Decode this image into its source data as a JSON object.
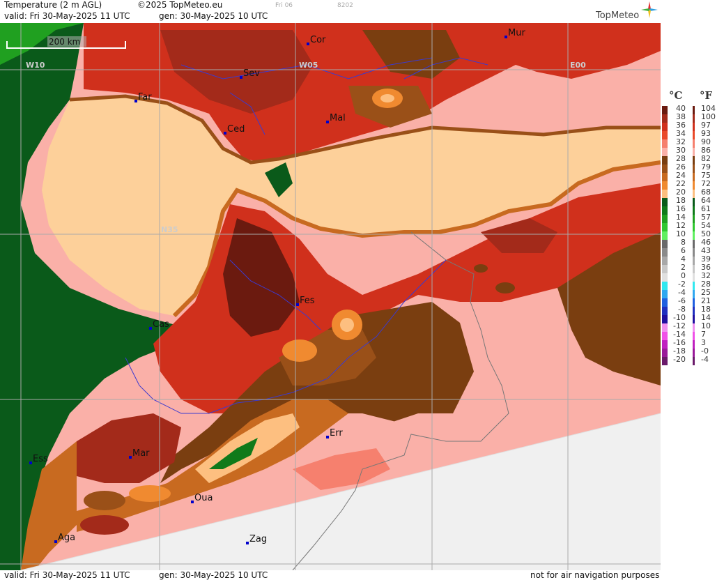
{
  "header": {
    "title": "Temperature (2 m AGL)",
    "copyright": "©2025 TopMeteo.eu",
    "day_tag": "Fri 06",
    "code": "8202",
    "valid": "valid:  Fri  30-May-2025  11 UTC",
    "gen": "gen: 30-May-2025 10 UTC",
    "brand": "TopMeteo"
  },
  "footer": {
    "valid": "valid:  Fri  30-May-2025  11 UTC",
    "gen": "gen: 30-May-2025 10 UTC",
    "notice": "not for air navigation purposes"
  },
  "map": {
    "scale_label": "200 km",
    "grid_labels": {
      "w10": "W10",
      "w05": "W05",
      "e00": "E00",
      "n35": "N35"
    },
    "cities": [
      {
        "name": "Cor"
      },
      {
        "name": "Mur"
      },
      {
        "name": "Sev"
      },
      {
        "name": "Far"
      },
      {
        "name": "Mal"
      },
      {
        "name": "Ced"
      },
      {
        "name": "Fes"
      },
      {
        "name": "Cas"
      },
      {
        "name": "Err"
      },
      {
        "name": "Mar"
      },
      {
        "name": "Ess"
      },
      {
        "name": "Oua"
      },
      {
        "name": "Aga"
      },
      {
        "name": "Zag"
      }
    ],
    "colors": {
      "sea": "#fdd09a",
      "no_data": "#f0f0f0",
      "city_marker": "#0000cc"
    }
  },
  "legend": {
    "unit_c": "°C",
    "unit_f": "°F",
    "celsius": [
      "40",
      "38",
      "36",
      "34",
      "32",
      "30",
      "28",
      "26",
      "24",
      "22",
      "20",
      "18",
      "16",
      "14",
      "12",
      "10",
      "8",
      "6",
      "4",
      "2",
      "0",
      "-2",
      "-4",
      "-6",
      "-8",
      "-10",
      "-12",
      "-14",
      "-16",
      "-18",
      "-20"
    ],
    "fahrenheit": [
      "104",
      "100",
      "97",
      "93",
      "90",
      "86",
      "82",
      "79",
      "75",
      "72",
      "68",
      "64",
      "61",
      "57",
      "54",
      "50",
      "46",
      "43",
      "39",
      "36",
      "32",
      "28",
      "25",
      "21",
      "18",
      "14",
      "10",
      "7",
      "3",
      "-0",
      "-4"
    ],
    "colors": [
      "#6b1a0f",
      "#a32a1a",
      "#d0301c",
      "#ea4a2a",
      "#f6806e",
      "#fab0a8",
      "#7a3e10",
      "#9a5018",
      "#c86a20",
      "#f08a30",
      "#fdbf80",
      "#0a5a1a",
      "#107a1a",
      "#20a020",
      "#30c830",
      "#60f060",
      "#6a6a6a",
      "#8a8a8a",
      "#a8a8a8",
      "#c8c8c8",
      "#e0e0e0",
      "#30e8f0",
      "#30a8f0",
      "#2060e0",
      "#2030c0",
      "#2010a0",
      "#f090f0",
      "#f050e8",
      "#c020c0",
      "#9a1a9a",
      "#6a1a6a"
    ]
  }
}
